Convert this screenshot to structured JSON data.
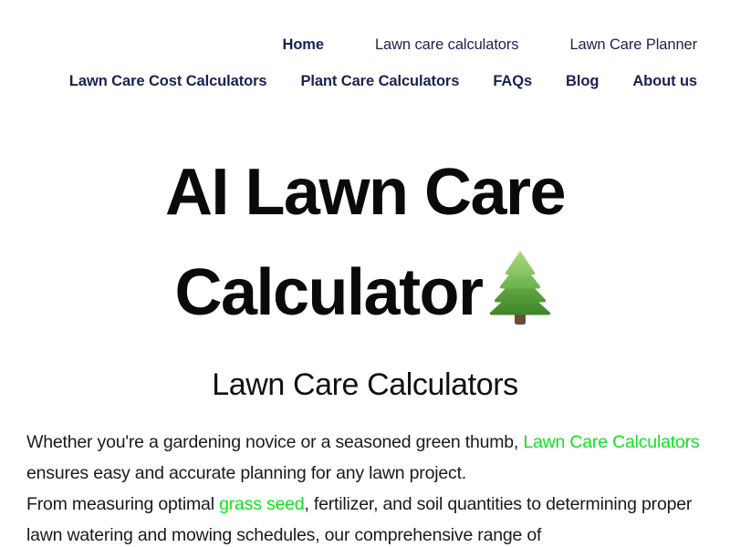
{
  "colors": {
    "nav_text": "#1b2153",
    "heading": "#0a0a0a",
    "subheading": "#111111",
    "body_text": "#1a1a1a",
    "link_green": "#10e222",
    "background": "#ffffff",
    "tree_light": "#8fc86a",
    "tree_mid": "#6aad4a",
    "tree_dark": "#4a8c32",
    "tree_trunk": "#6b4a38"
  },
  "nav": {
    "row1": [
      {
        "label": "Home",
        "weight": "bold"
      },
      {
        "label": "Lawn care calculators",
        "weight": "regular"
      },
      {
        "label": "Lawn Care Planner",
        "weight": "regular"
      }
    ],
    "row2": [
      {
        "label": "Lawn Care Cost Calculators",
        "weight": "semi"
      },
      {
        "label": "Plant Care Calculators",
        "weight": "semi"
      },
      {
        "label": "FAQs",
        "weight": "bold"
      },
      {
        "label": "Blog",
        "weight": "bold"
      },
      {
        "label": "About us",
        "weight": "bold"
      }
    ]
  },
  "hero": {
    "title_line_1": "AI Lawn Care",
    "title_line_2": "Calculator",
    "tree_icon": "evergreen-tree-emoji"
  },
  "subheading": "Lawn Care Calculators",
  "body": {
    "seg_1": "Whether you're a gardening novice or a seasoned green thumb, ",
    "link_1": "Lawn Care Calculators",
    "seg_2": " ensures easy and accurate planning for any lawn project.",
    "seg_3": "From measuring optimal ",
    "link_2": "grass seed",
    "seg_4": ", fertilizer, and soil quantities to determining proper lawn watering and mowing schedules, our comprehensive range of"
  }
}
